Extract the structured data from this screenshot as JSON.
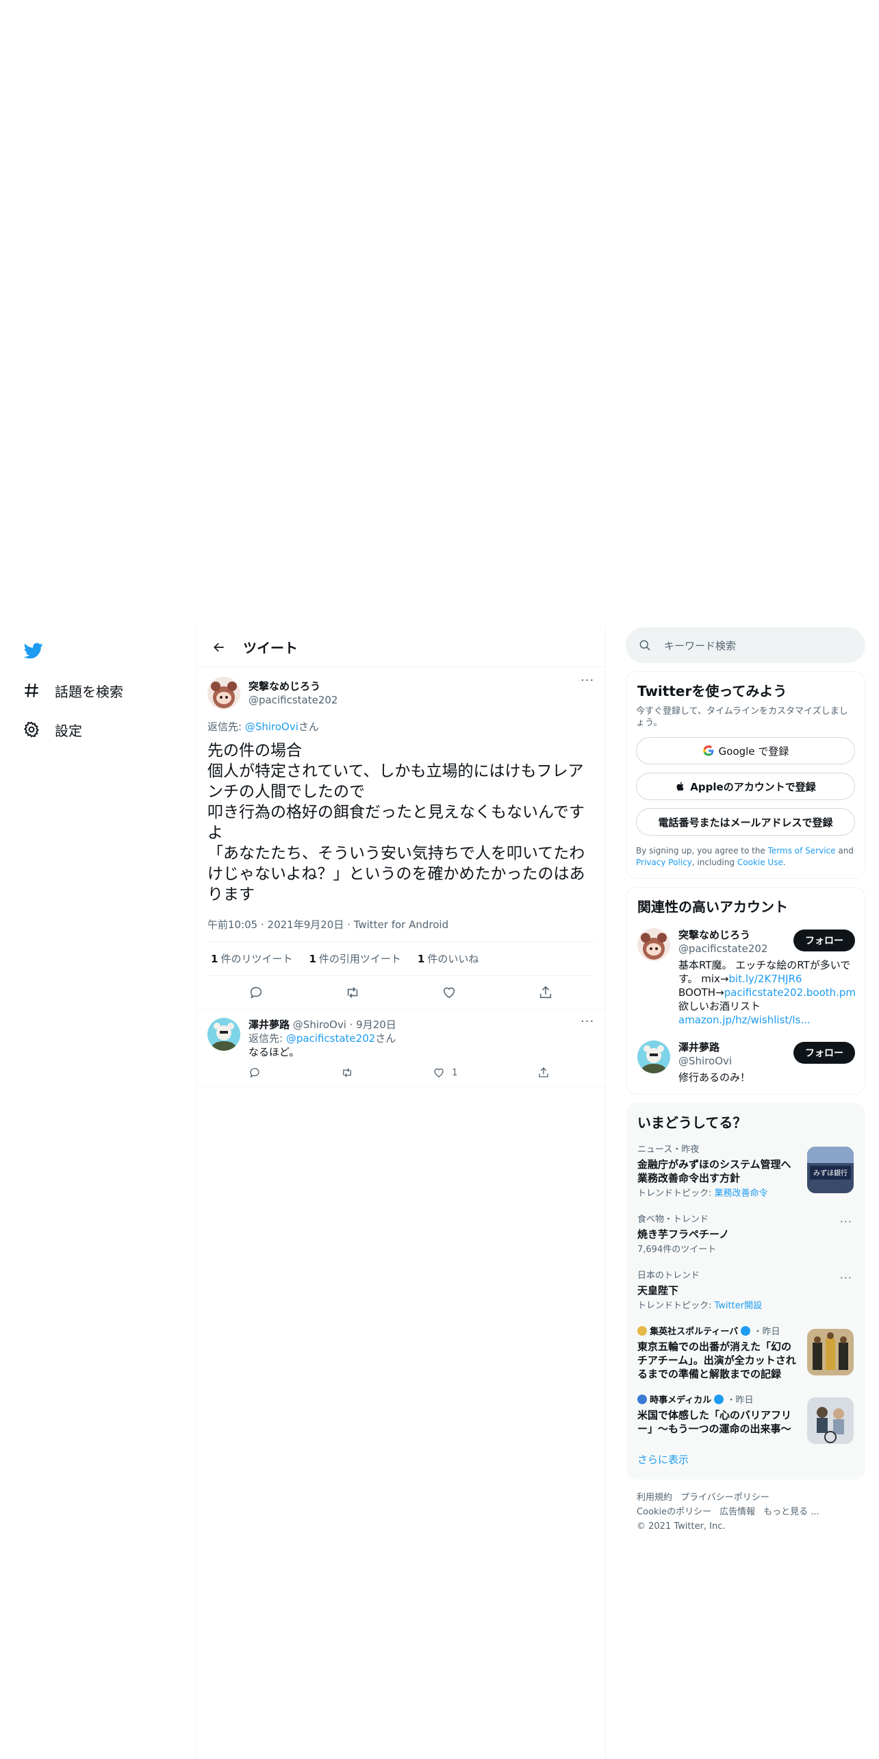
{
  "nav": {
    "items": [
      {
        "label": "話題を検索",
        "icon": "hashtag-icon"
      },
      {
        "label": "設定",
        "icon": "gear-icon"
      }
    ]
  },
  "header": {
    "title": "ツイート"
  },
  "tweet": {
    "name": "突撃なめじろう",
    "handle": "@pacificstate202",
    "reply_prefix": "返信先: ",
    "reply_handle": "@ShiroOvi",
    "reply_suffix": "さん",
    "text": "先の件の場合\n個人が特定されていて、しかも立場的にはけもフレアンチの人間でしたので\n叩き行為の格好の餌食だったと見えなくもないんですよ\n「あなたたち、そういう安い気持ちで人を叩いてたわけじゃないよね？」というのを確かめたかったのはあります",
    "time": "午前10:05",
    "date": "2021年9月20日",
    "client": "Twitter for Android",
    "retweets_count": "1",
    "retweets_label": "件のリツイート",
    "quotes_count": "1",
    "quotes_label": "件の引用ツイート",
    "likes_count": "1",
    "likes_label": "件のいいね"
  },
  "reply": {
    "name": "澤井夢路",
    "handle": "@ShiroOvi",
    "date": "9月20日",
    "reply_prefix": "返信先: ",
    "reply_handle": "@pacificstate202",
    "reply_suffix": "さん",
    "text": "なるほど。",
    "like_count": "1"
  },
  "search": {
    "placeholder": "キーワード検索"
  },
  "signup": {
    "title": "Twitterを使ってみよう",
    "subtitle": "今すぐ登録して、タイムラインをカスタマイズしましょう。",
    "google_label": "Google で登録",
    "apple_label": "Appleのアカウントで登録",
    "phone_label": "電話番号またはメールアドレスで登録",
    "terms_prefix": "By signing up, you agree to the ",
    "terms_link": "Terms of Service",
    "terms_and": " and ",
    "privacy_link": "Privacy Policy",
    "terms_including": ", including ",
    "cookie_link": "Cookie Use",
    "terms_end": "."
  },
  "related": {
    "title": "関連性の高いアカウント",
    "accounts": [
      {
        "name": "突撃なめじろう",
        "handle": "@pacificstate202",
        "follow": "フォロー",
        "bio_line1": "基本RT魔。 エッチな絵のRTが多いです。 mix→",
        "bio_link1": "bit.ly/2K7HJR6",
        "bio_line2": "BOOTH→",
        "bio_link2": "pacificstate202.booth.pm",
        "bio_line3": "欲しいお酒リスト",
        "bio_link3": "amazon.jp/hz/wishlist/ls..."
      },
      {
        "name": "澤井夢路",
        "handle": "@ShiroOvi",
        "follow": "フォロー",
        "bio": "修行あるのみ！"
      }
    ]
  },
  "trends": {
    "title": "いまどうしてる？",
    "items": [
      {
        "context": "ニュース・昨夜",
        "title": "金融庁がみずほのシステム管理へ業務改善命令出す方針",
        "sub_prefix": "トレンドトピック: ",
        "sub_link": "業務改善命令",
        "thumb_text": "みずほ銀行"
      },
      {
        "context": "食べ物・トレンド",
        "title": "焼き芋フラペチーノ",
        "sub": "7,694件のツイート"
      },
      {
        "context": "日本のトレンド",
        "title": "天皇陛下",
        "sub_prefix": "トレンドトピック: ",
        "sub_link": "Twitter開設"
      },
      {
        "context_name": "集英社スポルティーバ",
        "context_time": "・昨日",
        "title": "東京五輪での出番が消えた「幻のチアチーム」。出演が全カットされるまでの準備と解散までの記録"
      },
      {
        "context_name": "時事メディカル",
        "context_time": "・昨日",
        "title": "米国で体感した「心のバリアフリー」～もう一つの運命の出来事～"
      }
    ],
    "show_more": "さらに表示"
  },
  "footer": {
    "links1": [
      "利用規約",
      "プライバシーポリシー"
    ],
    "links2": [
      "Cookieのポリシー",
      "広告情報",
      "もっと見る ..."
    ],
    "copyright": "© 2021 Twitter, Inc."
  },
  "colors": {
    "accent": "#1d9bf0",
    "text": "#0f1419",
    "muted": "#536471",
    "border": "#eff3f4"
  }
}
